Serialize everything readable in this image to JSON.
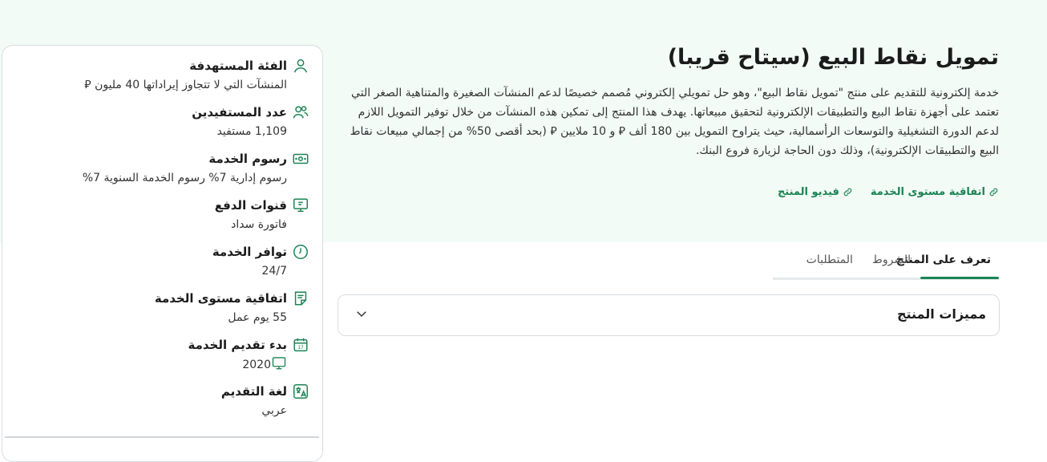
{
  "product": {
    "title": "تمويل نقاط البيع (سيتاح قريبا)",
    "description": "خدمة إلكترونية للتقديم على منتج \"تمويل نقاط البيع\"، وهو حل تمويلي إلكتروني مُصمم خصيصًا لدعم المنشآت الصغيرة والمتناهية الصغر التي تعتمد على أجهزة نقاط البيع والتطبيقات الإلكترونية لتحقيق مبيعاتها. يهدف هذا المنتج إلى تمكين هذه المنشآت من خلال توفير التمويل اللازم لدعم الدورة التشغيلية والتوسعات الرأسمالية، حيث يتراوح التمويل بين 180 ألف ⃁ و 10 ملايين ⃁ (بحد أقصى 50% من إجمالي مبيعات نقاط البيع والتطبيقات الإلكترونية)، وذلك دون الحاجة لزيارة فروع البنك.",
    "links": [
      {
        "label": "اتفاقية مستوى الخدمة",
        "icon": "link-icon"
      },
      {
        "label": "فيديو المنتج",
        "icon": "link-icon"
      }
    ]
  },
  "tabs": [
    {
      "label": "تعرف على المنتج",
      "active": true
    },
    {
      "label": "الشروط",
      "active": false
    },
    {
      "label": "المتطلبات",
      "active": false
    }
  ],
  "accordion": {
    "title": "مميزات المنتج",
    "icon": "chevron-down-icon"
  },
  "sidebar": {
    "items": [
      {
        "title": "الفئة المستهدفة",
        "value": "المنشآت التي لا تتجاوز إيراداتها 40 مليون ⃁",
        "icon": "user-icon"
      },
      {
        "title": "عدد المستفيدين",
        "value": "1,109 مستفيد",
        "icon": "users-icon"
      },
      {
        "title": "رسوم الخدمة",
        "value": "رسوم إدارية 7% رسوم الخدمة السنوية 7%",
        "icon": "money-icon"
      },
      {
        "title": "قنوات الدفع",
        "value": "فاتورة سداد",
        "icon": "monitor-icon"
      },
      {
        "title": "توافر الخدمة",
        "value": "24/7",
        "icon": "clock-icon"
      },
      {
        "title": "اتفاقية مستوى الخدمة",
        "value": "55 يوم عمل",
        "icon": "document-icon"
      },
      {
        "title": "بدء تقديم الخدمة",
        "value": "2020",
        "icon": "calendar-icon",
        "value_icon": "monitor-icon"
      },
      {
        "title": "لغة التقديم",
        "value": "عربي",
        "icon": "translate-icon"
      }
    ]
  }
}
